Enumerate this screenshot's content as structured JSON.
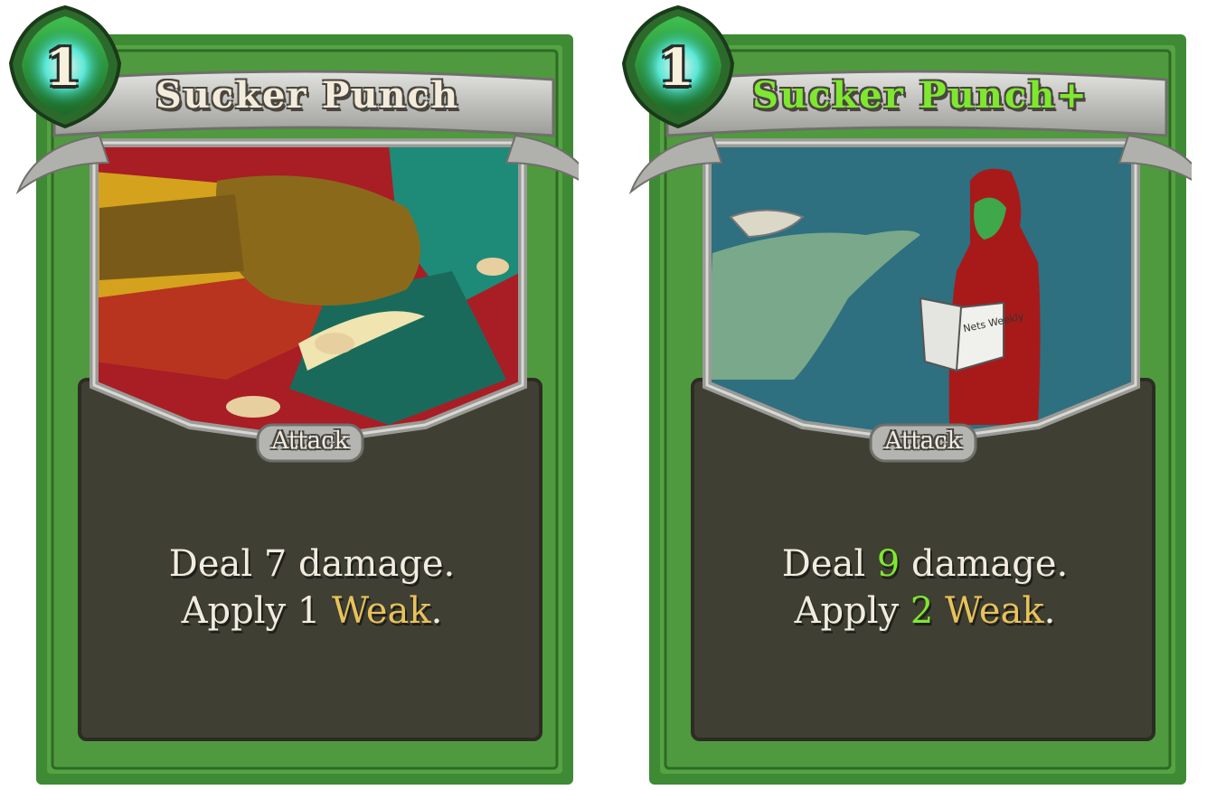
{
  "cards": [
    {
      "cost": "1",
      "title": "Sucker Punch",
      "type": "Attack",
      "description": {
        "line1_prefix": "Deal ",
        "damage": "7",
        "line1_suffix": " damage.",
        "line2_prefix": "Apply ",
        "weak_amount": "1",
        "keyword": "Weak",
        "line2_suffix": "."
      },
      "upgraded": false,
      "art_icon": "fist-punch-art"
    },
    {
      "cost": "1",
      "title": "Sucker Punch+",
      "type": "Attack",
      "description": {
        "line1_prefix": "Deal ",
        "damage": "9",
        "line1_suffix": " damage.",
        "line2_prefix": "Apply ",
        "weak_amount": "2",
        "keyword": "Weak",
        "line2_suffix": "."
      },
      "upgraded": true,
      "art_icon": "hooded-figure-reading-art",
      "art_text": "Nets Weekly"
    }
  ],
  "colors": {
    "card_green": "#4f9a3e",
    "card_green_dark": "#2f6a26",
    "text_panel": "#3f3f33",
    "upgrade_green": "#7ee830",
    "keyword_gold": "#e8c25a"
  }
}
